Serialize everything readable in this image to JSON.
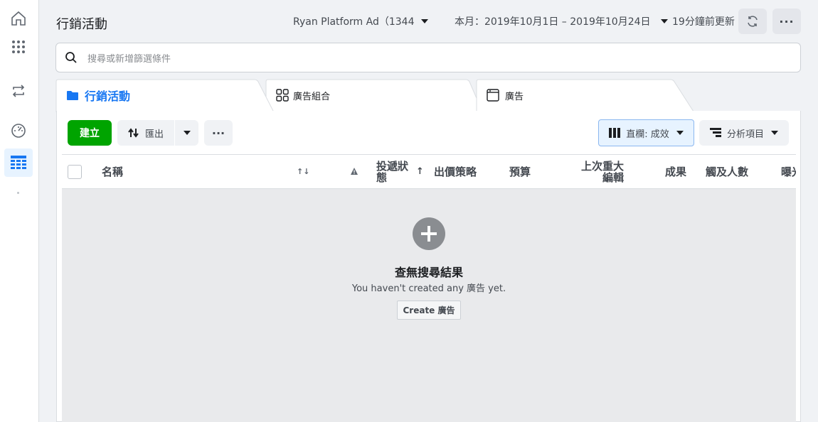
{
  "header": {
    "title": "行銷活動",
    "account": "Ryan Platform Ad（1344...",
    "date_range": "本月：2019年10月1日 – 2019年10月24日",
    "updated": "19分鐘前更新"
  },
  "search": {
    "placeholder": "搜尋或新增篩選條件"
  },
  "tabs": [
    {
      "label": "行銷活動",
      "icon": "folder-icon",
      "active": true
    },
    {
      "label": "廣告組合",
      "icon": "grid-icon",
      "active": false
    },
    {
      "label": "廣告",
      "icon": "ad-window-icon",
      "active": false
    }
  ],
  "toolbar": {
    "create_label": "建立",
    "export_label": "匯出",
    "columns_label": "直欄: 成效",
    "breakdown_label": "分析項目"
  },
  "table": {
    "columns": [
      "名稱",
      "投遞狀態",
      "出價策略",
      "預算",
      "上次重大編輯",
      "成果",
      "觸及人數",
      "曝光"
    ],
    "delivery_line1": "投遞狀",
    "delivery_line2": "態",
    "edit_line1": "上次重大",
    "edit_line2": "編輯"
  },
  "empty_state": {
    "title": "查無搜尋結果",
    "subtitle": "You haven't created any 廣告 yet.",
    "button": "Create 廣告"
  },
  "colors": {
    "accent": "#1877f2",
    "create": "#00a400"
  }
}
